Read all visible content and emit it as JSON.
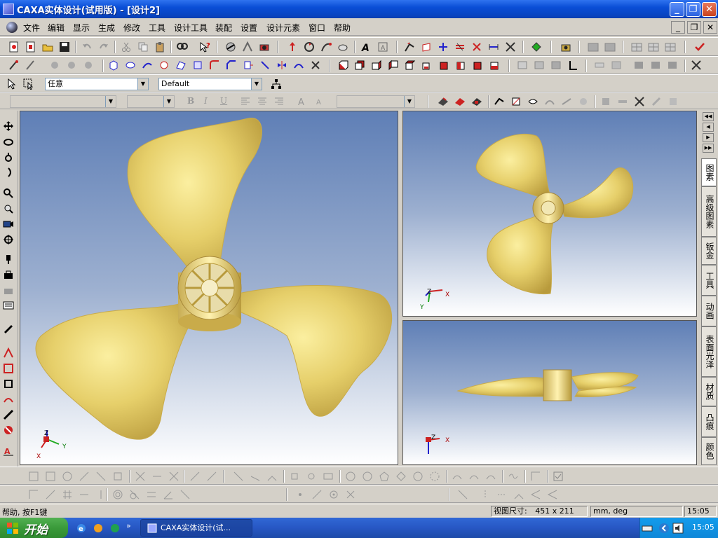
{
  "window": {
    "title": "CAXA实体设计(试用版) - [设计2]",
    "min": "_",
    "max": "❐",
    "close": "✕"
  },
  "menu": {
    "items": [
      "文件",
      "编辑",
      "显示",
      "生成",
      "修改",
      "工具",
      "设计工具",
      "装配",
      "设置",
      "设计元素",
      "窗口",
      "帮助"
    ],
    "mdi_min": "_",
    "mdi_restore": "❐",
    "mdi_close": "✕"
  },
  "toolbar3": {
    "select_filter": "任意",
    "style_select": "Default"
  },
  "toolbar4": {
    "bold": "B",
    "italic": "I",
    "underline": "U"
  },
  "viewports": {
    "main": {
      "axes": {
        "z": "Z",
        "y": "Y",
        "x": "X"
      }
    },
    "top_right": {
      "axes": {
        "z": "Z",
        "y": "Y",
        "x": "X"
      }
    },
    "bottom_right": {
      "axes": {
        "z": "Z",
        "x": "X"
      }
    }
  },
  "right_tabs": [
    "图素",
    "高级图素",
    "钣金",
    "工具",
    "动画",
    "表面光泽",
    "材质",
    "凸痕",
    "颜色"
  ],
  "statusbar": {
    "help": "帮助, 按F1键",
    "view_size_label": "视图尺寸:",
    "view_size_value": "451 x 211",
    "units": "mm, deg",
    "time": "15:05"
  },
  "taskbar": {
    "start": "开始",
    "task": "CAXA实体设计(试...",
    "time": "15:05"
  },
  "colors": {
    "title_blue": "#0a4ed6",
    "propeller_gold": "#e6cf6a",
    "start_green": "#3a9a3a"
  }
}
